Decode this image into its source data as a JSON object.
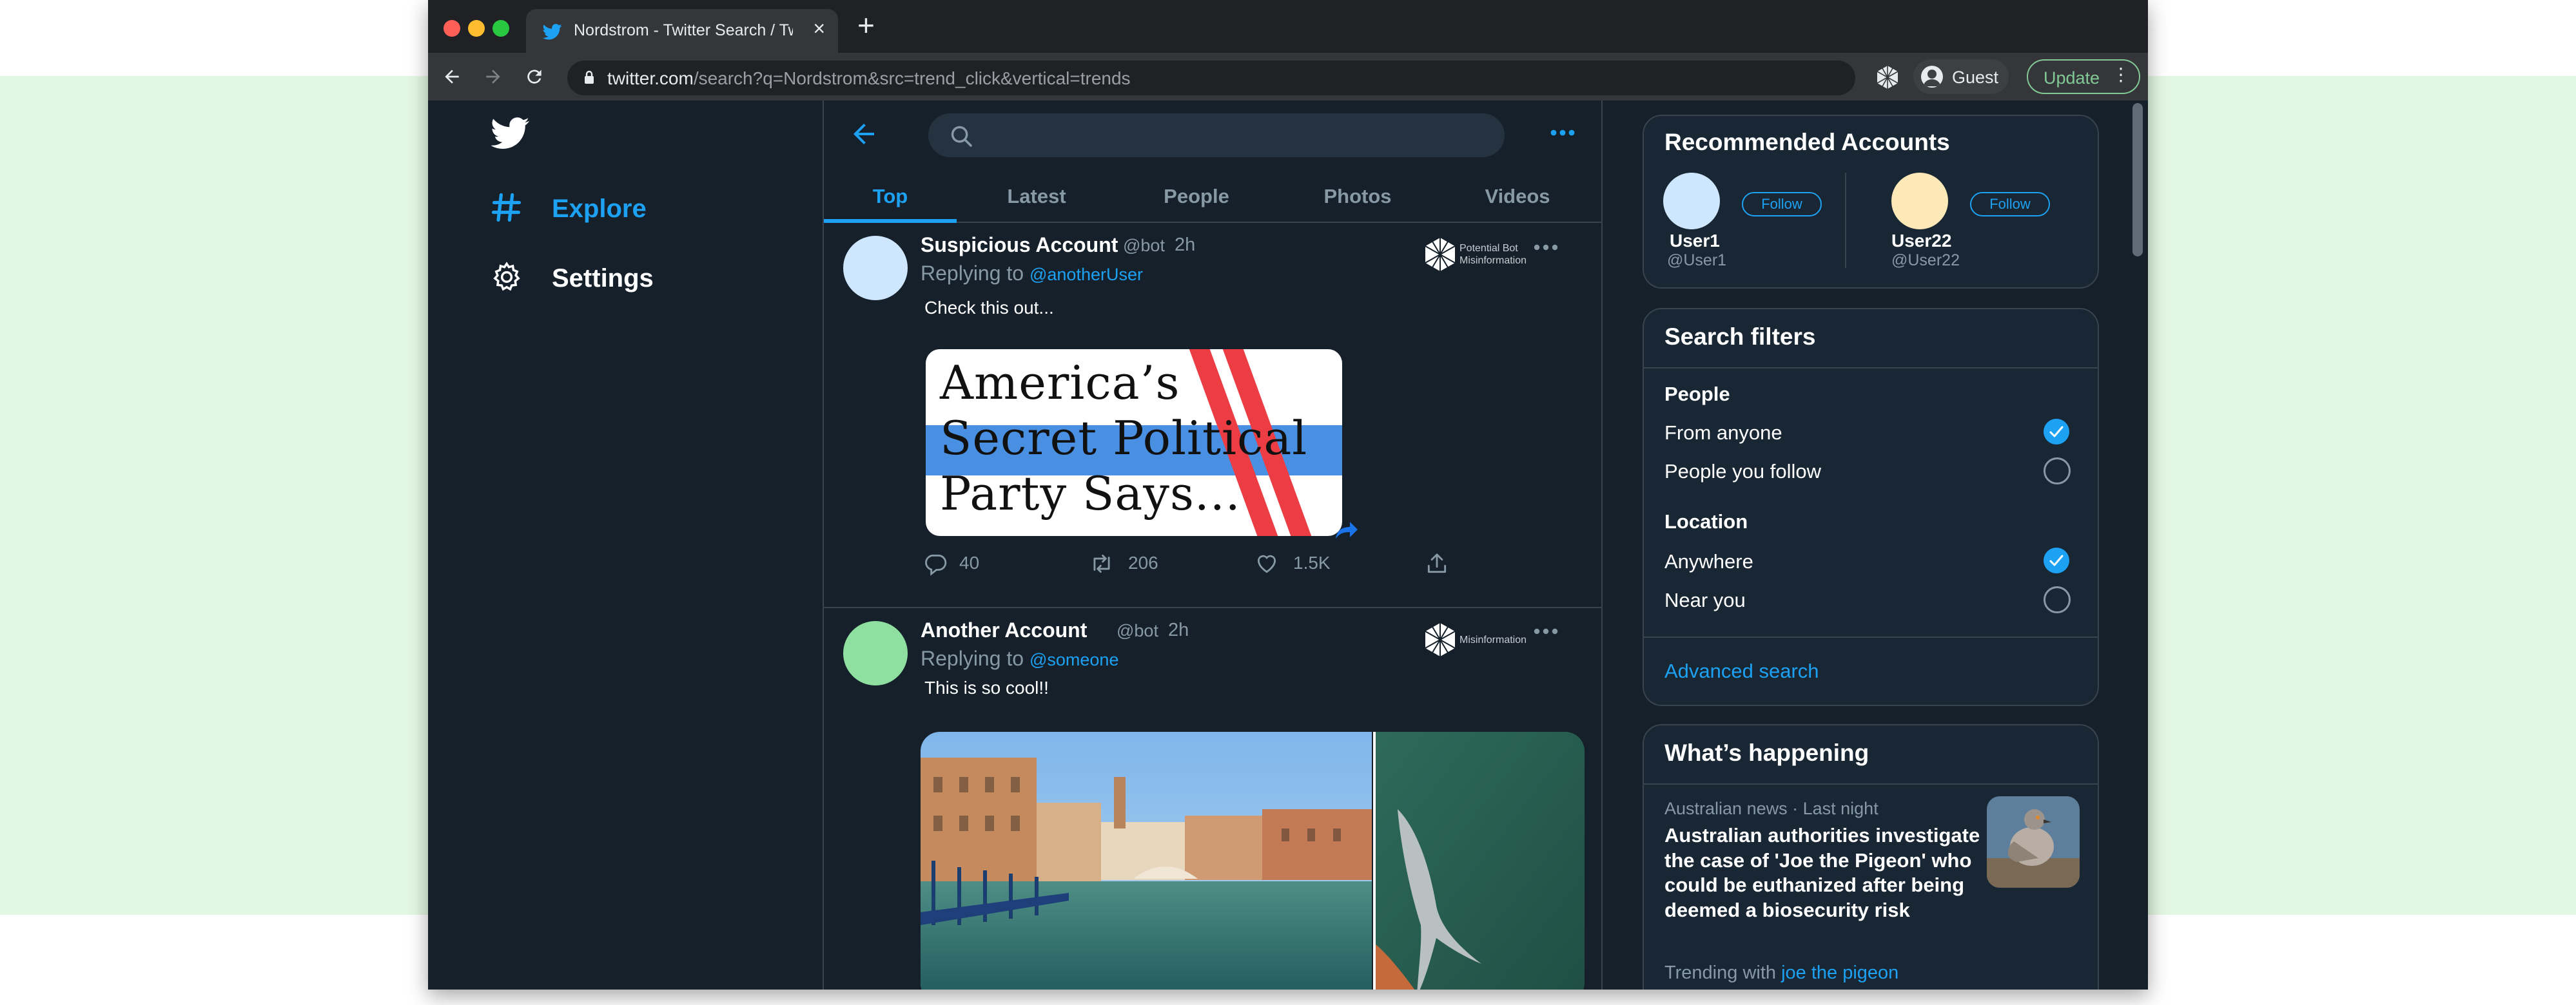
{
  "browser": {
    "tab_title": "Nordstrom - Twitter Search / Twitter",
    "new_tab_label": "+",
    "tab_close_label": "×",
    "url_host": "twitter.com",
    "url_path": "/search?q=Nordstrom&src=trend_click&vertical=trends",
    "profile_label": "Guest",
    "update_label": "Update"
  },
  "sidebar": {
    "items": [
      {
        "label": "Explore",
        "icon": "hashtag-icon",
        "color": "#1da1f2"
      },
      {
        "label": "Settings",
        "icon": "gear-icon",
        "color": "#ffffff"
      }
    ]
  },
  "search": {
    "placeholder": ""
  },
  "tabs": [
    "Top",
    "Latest",
    "People",
    "Photos",
    "Videos"
  ],
  "tweets": [
    {
      "name": "Suspicious Account",
      "handle": "@bot",
      "time": "2h",
      "replying_prefix": "Replying to ",
      "replying_to": "@anotherUser",
      "text": "Check this out...",
      "badge": "Potential Bot Misinformation",
      "avatar_color": "#cfe6ff",
      "media_lines": [
        "America’s",
        "Secret Political",
        "Party Says..."
      ],
      "replies": "40",
      "retweets": "206",
      "likes": "1.5K"
    },
    {
      "name": "Another Account",
      "handle": "@bot",
      "time": "2h",
      "replying_prefix": "Replying to ",
      "replying_to": "@someone",
      "text": "This is so cool!!",
      "badge": "Misinformation",
      "avatar_color": "#8fdfa0"
    }
  ],
  "recommended": {
    "title": "Recommended Accounts",
    "accounts": [
      {
        "name": "User1",
        "handle": "@User1",
        "follow_label": "Follow",
        "avatar_color": "#cfe6ff"
      },
      {
        "name": "User22",
        "handle": "@User22",
        "follow_label": "Follow",
        "avatar_color": "#fde9b8"
      }
    ]
  },
  "filters": {
    "title": "Search filters",
    "people_label": "People",
    "people_options": [
      {
        "label": "From anyone",
        "checked": true
      },
      {
        "label": "People you follow",
        "checked": false
      }
    ],
    "location_label": "Location",
    "location_options": [
      {
        "label": "Anywhere",
        "checked": true
      },
      {
        "label": "Near you",
        "checked": false
      }
    ],
    "advanced_label": "Advanced search"
  },
  "happening": {
    "title": "What’s happening",
    "category": "Australian news",
    "separator": " · ",
    "when": "Last night",
    "headline": "Australian authorities investigate the case of 'Joe the Pigeon' who could be euthanized after being deemed a biosecurity risk",
    "trending_prefix": "Trending with",
    "trending_link": "joe the pigeon"
  },
  "colors": {
    "accent": "#1da1f2",
    "background": "#15202b",
    "card": "#192734",
    "border": "#38444d",
    "secondary_text": "#8899a6"
  }
}
